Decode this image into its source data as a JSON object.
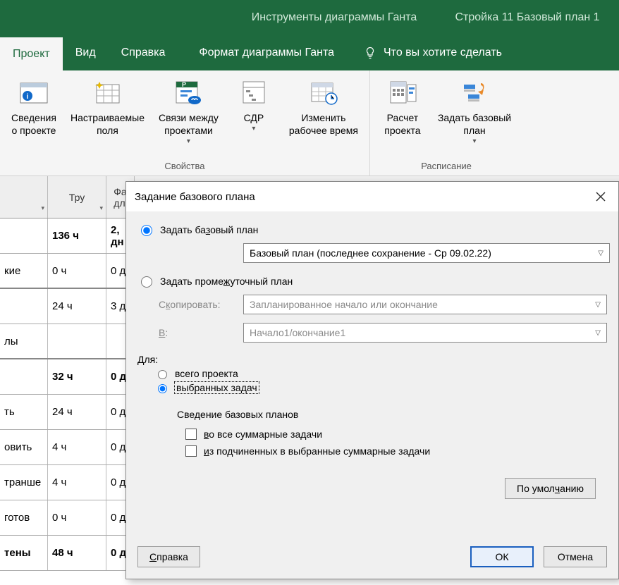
{
  "titlebar": {
    "subtitle": "Инструменты диаграммы Ганта",
    "filename": "Стройка 11 Базовый план 1"
  },
  "tabs": {
    "project": "Проект",
    "view": "Вид",
    "help": "Справка",
    "gantt_format": "Формат диаграммы Ганта",
    "tellme": "Что вы хотите сделать"
  },
  "ribbon": {
    "group_props": "Свойства",
    "group_schedule": "Расписание",
    "items": {
      "info": "Сведения\nо проекте",
      "fields": "Настраиваемые\nполя",
      "links": "Связи между\nпроектами",
      "wbs": "СДР",
      "worktime": "Изменить\nрабочее время",
      "calc": "Расчет\nпроекта",
      "baseline": "Задать базовый\nплан"
    }
  },
  "sheet": {
    "headers": {
      "col0": "",
      "col1": "Тру",
      "col2": "Фа\nдл"
    },
    "rows": [
      {
        "c0": "",
        "c1": "136 ч",
        "c2": "2,\nдн",
        "bold": true
      },
      {
        "c0": "кие",
        "c1": "0 ч",
        "c2": "0 д",
        "summary": true
      },
      {
        "c0": "",
        "c1": "24 ч",
        "c2": "3 д"
      },
      {
        "c0": "лы",
        "c1": "",
        "c2": "",
        "summary": true
      },
      {
        "c0": "",
        "c1": "32 ч",
        "c2": "0 д",
        "bold": true
      },
      {
        "c0": "ть",
        "c1": "24 ч",
        "c2": "0 д"
      },
      {
        "c0": "овить",
        "c1": "4 ч",
        "c2": "0 д"
      },
      {
        "c0": "транше",
        "c1": "4 ч",
        "c2": "0 д"
      },
      {
        "c0": "готов",
        "c1": "0 ч",
        "c2": "0 д"
      },
      {
        "c0": "тены",
        "c1": "48 ч",
        "c2": "0 д",
        "bold": true
      }
    ]
  },
  "dialog": {
    "title": "Задание базового плана",
    "set_baseline": "Задать базовый план",
    "baseline_combo": "Базовый план (последнее сохранение - Ср 09.02.22)",
    "set_interim": "Задать промежуточный план",
    "copy_label_pre": "С",
    "copy_label_u": "к",
    "copy_label_post": "опировать:",
    "copy_combo": "Запланированное начало или окончание",
    "into_label_u": "В",
    "into_label_post": ":",
    "into_combo": "Начало1/окончание1",
    "for_label": "Для:",
    "for_all": "всего проекта",
    "for_selected": "выбранных задач",
    "rollup_header": "Сведение базовых планов",
    "rollup1_u": "в",
    "rollup1_post": "о все суммарные задачи",
    "rollup2_u": "и",
    "rollup2_post": "з подчиненных в выбранные суммарные задачи",
    "defaults_pre": "По умол",
    "defaults_u": "ч",
    "defaults_post": "анию",
    "help_u": "С",
    "help_post": "правка",
    "ok": "ОК",
    "cancel": "Отмена"
  }
}
